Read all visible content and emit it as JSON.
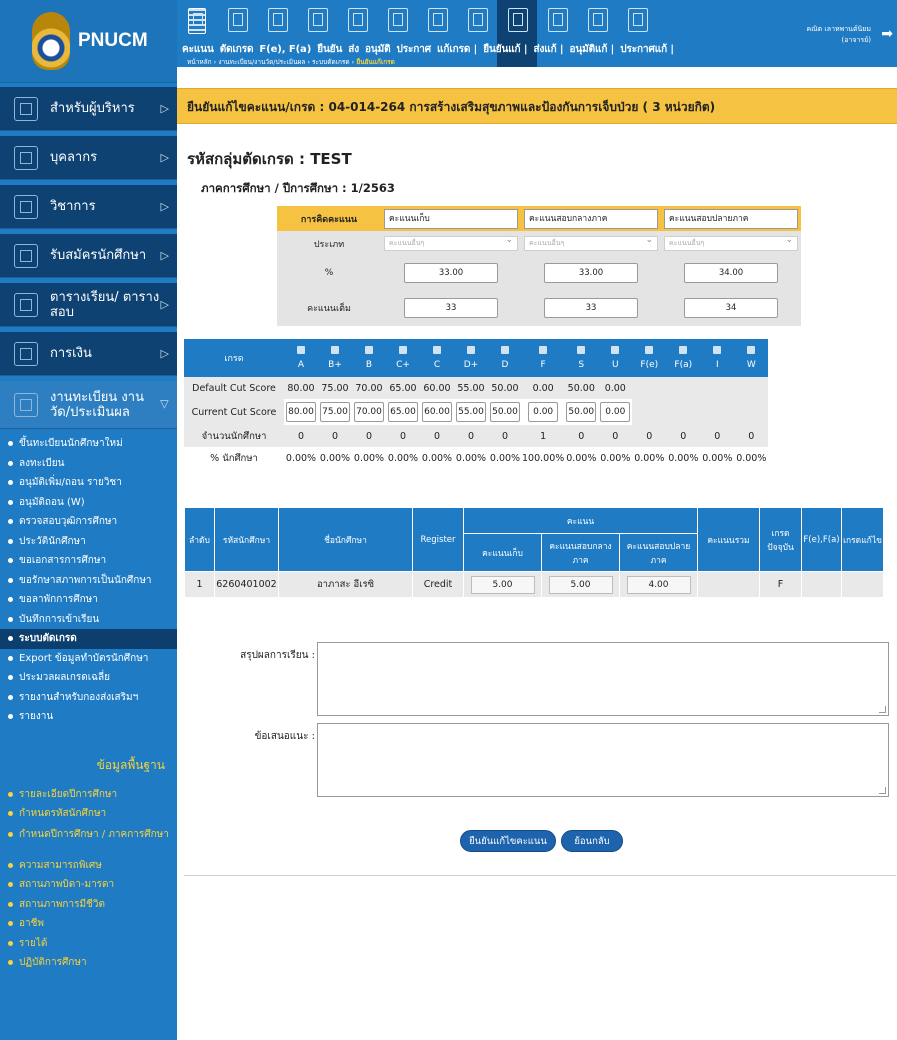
{
  "brand": {
    "name": "PNUCM"
  },
  "sidebar": {
    "menus": [
      {
        "label": "สำหรับผู้บริหาร"
      },
      {
        "label": "บุคลากร"
      },
      {
        "label": "วิชาการ"
      },
      {
        "label": "รับสมัครนักศึกษา"
      },
      {
        "label": "ตารางเรียน/ ตารางสอบ"
      },
      {
        "label": "การเงิน"
      }
    ],
    "active_menu": {
      "label": "งานทะเบียน งานวัด/ประเมินผล"
    },
    "sub_items": [
      "ขึ้นทะเบียนนักศึกษาใหม่",
      "ลงทะเบียน",
      "อนุมัติเพิ่ม/ถอน รายวิชา",
      "อนุมัติถอน (W)",
      "ตรวจสอบวุฒิการศึกษา",
      "ประวัตินักศึกษา",
      "ขอเอกสารการศึกษา",
      "ขอรักษาสภาพการเป็นนักศึกษา",
      "ขอลาพักการศึกษา",
      "บันทึกการเข้าเรียน",
      "ระบบตัดเกรด",
      "Export ข้อมูลทำบัตรนักศึกษา",
      "ประมวลผลเกรดเฉลี่ย",
      "รายงานสำหรับกองส่งเสริมฯ",
      "รายงาน"
    ],
    "basic_header": "ข้อมูลพื้นฐาน",
    "basic_items": [
      "รายละเอียดปีการศึกษา",
      "กำหนดรหัสนักศึกษา",
      "กำหนดปีการศึกษา / ภาคการศึกษา",
      "ความสามารถพิเศษ",
      "สถานภาพบิดา-มารดา",
      "สถานภาพการมีชีวิต",
      "อาชีพ",
      "รายได้",
      "ปฏิบัติการศึกษา"
    ]
  },
  "topbar": {
    "tabs": [
      "คะแนน",
      "ตัดเกรด",
      "F(e), F(a)",
      "ยืนยัน",
      "ส่ง",
      "อนุมัติ",
      "ประกาศ",
      "แก้เกรด",
      "ยืนยันแก้",
      "ส่งแก้",
      "อนุมัติแก้",
      "ประกาศแก้"
    ],
    "tab_label_text": [
      "คะแนน",
      "ตัดเกรด",
      "F(e), F(a)",
      "ยืนยัน",
      "ส่ง",
      "อนุมัติ",
      "ประกาศ",
      "แก้เกรด |",
      "ยืนยันแก้ |",
      "ส่งแก้ |",
      "อนุมัติแก้ |",
      "ประกาศแก้ |"
    ],
    "breadcrumb": {
      "path": "หน้าหลัก › งานทะเบียน/งานวัด/ประเมินผล › ระบบตัดเกรด › ",
      "current": "ยืนยันแก้เกรด"
    },
    "user": {
      "name": "คณิต เลาหพานต์นิยม",
      "role": "(อาจารย์)"
    }
  },
  "page": {
    "title": "ยืนยันแก้ไขคะแนน/เกรด : 04-014-264 การสร้างเสริมสุขภาพและป้องกันการเจ็บป่วย ( 3 หน่วยกิต)",
    "group": "รหัสกลุ่มตัดเกรด : TEST",
    "term": "ภาคการศึกษา / ปีการศึกษา : 1/2563"
  },
  "weights": {
    "labels": {
      "method": "การคิดคะแนน",
      "type": "ประเภท",
      "percent": "%",
      "full": "คะแนนเต็ม"
    },
    "columns": [
      {
        "name": "คะแนนเก็บ",
        "type": "คะแนนอื่นๆ",
        "percent": "33.00",
        "full": "33"
      },
      {
        "name": "คะแนนสอบกลางภาค",
        "type": "คะแนนอื่นๆ",
        "percent": "33.00",
        "full": "33"
      },
      {
        "name": "คะแนนสอบปลายภาค",
        "type": "คะแนนอื่นๆ",
        "percent": "34.00",
        "full": "34"
      }
    ]
  },
  "grades": {
    "header": "เกรด",
    "cols": [
      "A",
      "B+",
      "B",
      "C+",
      "C",
      "D+",
      "D",
      "F",
      "S",
      "U",
      "F(e)",
      "F(a)",
      "I",
      "W"
    ],
    "rows": {
      "default_label": "Default Cut Score",
      "default": [
        "80.00",
        "75.00",
        "70.00",
        "65.00",
        "60.00",
        "55.00",
        "50.00",
        "0.00",
        "50.00",
        "0.00"
      ],
      "current_label": "Current Cut Score",
      "current": [
        "80.00",
        "75.00",
        "70.00",
        "65.00",
        "60.00",
        "55.00",
        "50.00",
        "0.00",
        "50.00",
        "0.00"
      ],
      "count_label": "จำนวนนักศึกษา",
      "count": [
        "0",
        "0",
        "0",
        "0",
        "0",
        "0",
        "0",
        "1",
        "0",
        "0",
        "0",
        "0",
        "0",
        "0"
      ],
      "pct_label": "% นักศึกษา",
      "pct": [
        "0.00%",
        "0.00%",
        "0.00%",
        "0.00%",
        "0.00%",
        "0.00%",
        "0.00%",
        "100.00%",
        "0.00%",
        "0.00%",
        "0.00%",
        "0.00%",
        "0.00%",
        "0.00%"
      ]
    }
  },
  "students": {
    "headers": {
      "seq": "ลำดับ",
      "id": "รหัสนักศึกษา",
      "name": "ชื่อนักศึกษา",
      "register": "Register",
      "score": "คะแนน",
      "s1": "คะแนนเก็บ",
      "s2": "คะแนนสอบกลาง ภาค",
      "s3": "คะแนนสอบปลาย ภาค",
      "total": "คะแนนรวม",
      "grade": "เกรด ปัจจุบัน",
      "fefa": "F(e),F(a)",
      "edit": "เกรดแก้ไข"
    },
    "rows": [
      {
        "seq": "1",
        "id": "6260401002",
        "name": "อาภาสะ อีเรซิ",
        "register": "Credit",
        "s1": "5.00",
        "s2": "5.00",
        "s3": "4.00",
        "total": "",
        "grade": "F",
        "fefa": "",
        "edit": ""
      }
    ]
  },
  "form": {
    "summary_label": "สรุปผลการเรียน :",
    "suggest_label": "ข้อเสนอแนะ :"
  },
  "buttons": {
    "confirm": "ยืนยันแก้ไขคะแนน",
    "back": "ย้อนกลับ"
  }
}
